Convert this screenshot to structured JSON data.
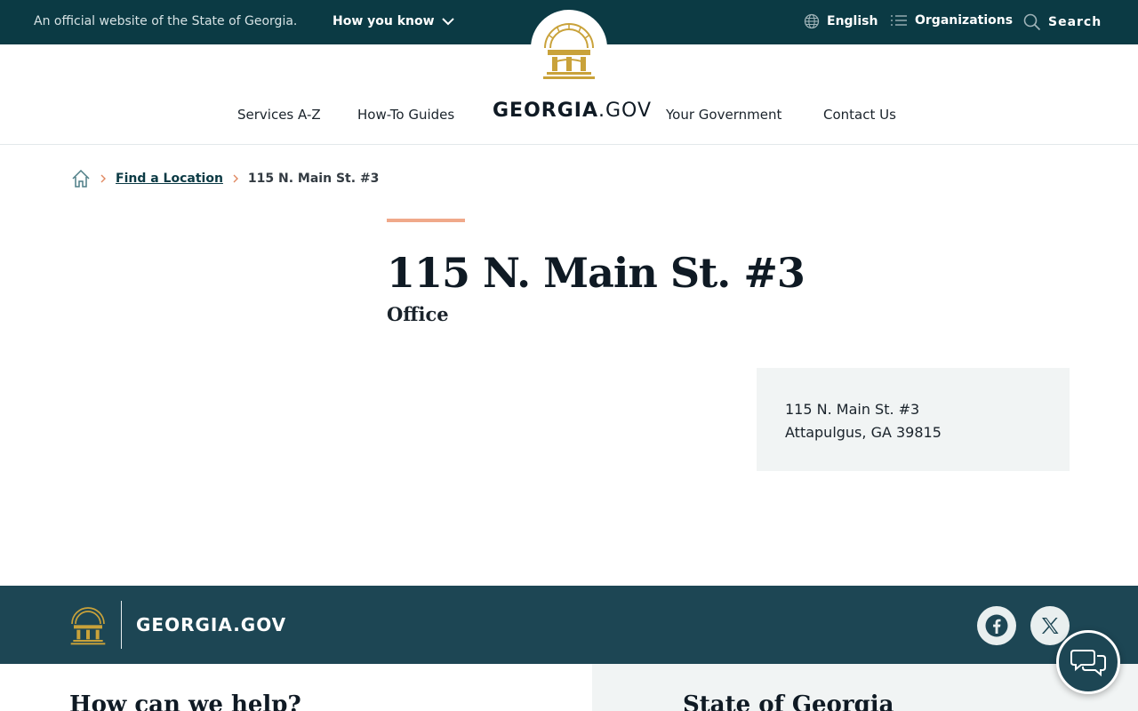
{
  "banner": {
    "official_text": "An official website of the State of Georgia.",
    "how_you_know": "How you know",
    "language": "English",
    "organizations": "Organizations",
    "search": "Search"
  },
  "header": {
    "nav": [
      "Services A-Z",
      "How-To Guides",
      "Your Government",
      "Contact Us"
    ],
    "brand_bold": "GEORGIA",
    "brand_light": ".GOV"
  },
  "breadcrumb": {
    "home_icon": "home-icon",
    "link": "Find a Location",
    "current": "115 N. Main St. #3"
  },
  "page": {
    "title": "115 N. Main St. #3",
    "subtitle": "Office"
  },
  "address": {
    "line1": "115 N. Main St. #3",
    "line2": "Attapulgus, GA 39815"
  },
  "footer": {
    "brand": "GEORGIA.GOV",
    "help_title": "How can we help?",
    "state_title": "State of Georgia"
  },
  "colors": {
    "banner_bg": "#0b3a44",
    "footer_bg": "#1d4654",
    "accent": "#f0a98a",
    "seal_gold": "#c9a23a"
  }
}
